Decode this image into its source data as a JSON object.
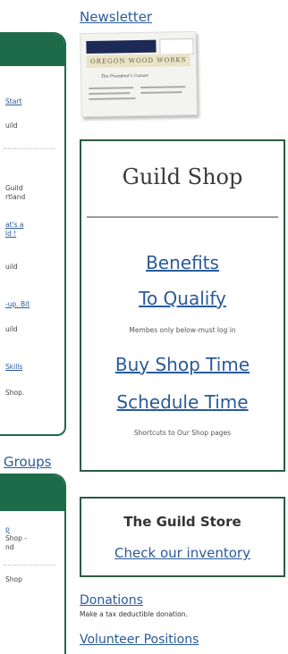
{
  "left_panel_1": {
    "items": [
      {
        "text": "Start",
        "kind": "link"
      },
      {
        "text": "uild",
        "kind": "text"
      },
      {
        "text": "Guild",
        "kind": "text"
      },
      {
        "text": "rtland",
        "kind": "text"
      },
      {
        "text": "at's a",
        "kind": "link"
      },
      {
        "text": "ld !",
        "kind": "link"
      },
      {
        "text": "uild",
        "kind": "text"
      },
      {
        "text": "-up. Bit",
        "kind": "link"
      },
      {
        "text": "uild",
        "kind": "text"
      },
      {
        "text": "Skills",
        "kind": "link"
      },
      {
        "text": "Shop.",
        "kind": "text"
      }
    ]
  },
  "groups_label": "Groups",
  "left_panel_2": {
    "items": [
      {
        "text": "p",
        "kind": "link"
      },
      {
        "text": "Shop -",
        "kind": "text"
      },
      {
        "text": "nd",
        "kind": "text"
      },
      {
        "text": "Shop",
        "kind": "text"
      }
    ]
  },
  "newsletter": {
    "link": "Newsletter",
    "thumb_title": "OREGON WOOD WORKS",
    "thumb_subtitle": "The President's Corner"
  },
  "guild_shop": {
    "title": "Guild Shop",
    "benefits": "Benefits",
    "to_qualify": "To Qualify",
    "members_note": "Membes only below-must log in",
    "buy_time": "Buy Shop Time",
    "schedule_time": "Schedule Time",
    "shortcuts_note": "Shortcuts to Our Shop pages"
  },
  "guild_store": {
    "title": "The Guild Store",
    "link": "Check our inventory"
  },
  "donations": {
    "link": "Donations",
    "note": "Make a tax deductible donation."
  },
  "volunteer": {
    "link": "Volunteer Positions"
  },
  "colors": {
    "panel_green": "#1e6b4a",
    "link_blue": "#2a5a9a"
  }
}
